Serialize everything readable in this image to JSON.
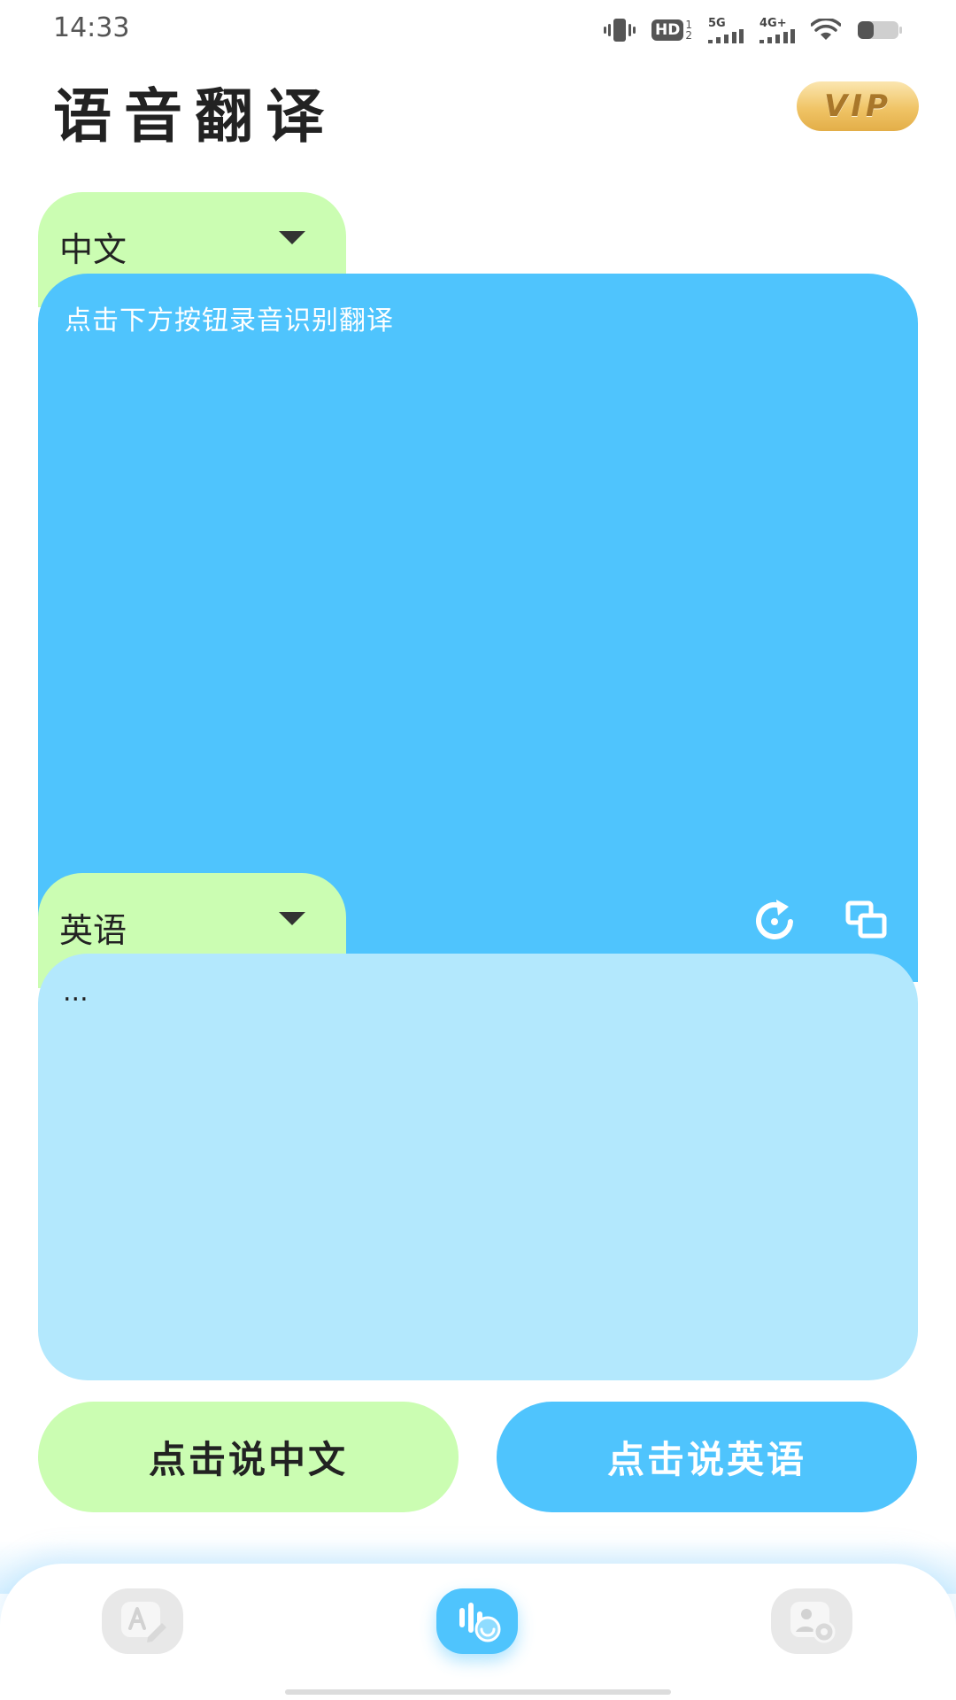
{
  "status_bar": {
    "time": "14:33",
    "hd_label": "HD",
    "network_5g": "5G",
    "network_4g": "4G+"
  },
  "header": {
    "title": "语音翻译",
    "vip_label": "VIP"
  },
  "source": {
    "language": "中文",
    "hint": "点击下方按钮录音识别翻译"
  },
  "target": {
    "language": "英语",
    "result_text": "..."
  },
  "actions": {
    "speak_source": "点击说中文",
    "speak_target": "点击说英语"
  },
  "icons": {
    "refresh": "refresh-icon",
    "copy": "copy-icon",
    "nav_text": "text-translate-icon",
    "nav_voice": "voice-translate-icon",
    "nav_photo": "photo-translate-icon"
  },
  "colors": {
    "accent_blue": "#4fc4fd",
    "accent_green": "#cbfdb2",
    "result_bg": "#b3e8fd",
    "vip_gold": "#f0c466"
  }
}
